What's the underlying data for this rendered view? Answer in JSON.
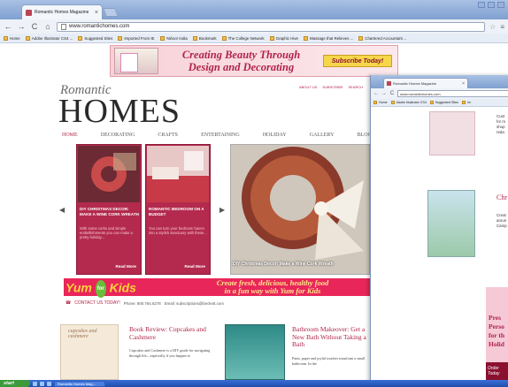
{
  "browser": {
    "tab_title": "Romantic Homes Magazine",
    "address": "www.romantichomes.com",
    "bookmarks": [
      "Home",
      "Adobe Illustrator CS4 ...",
      "Suggested Sites",
      "Imported From IE",
      "Yahoo! India",
      "Bookmark",
      "The College Network",
      "Graphic Hive",
      "Massage that Relieves ...",
      "Chartered Accountant ..."
    ]
  },
  "banner": {
    "line1": "Creating Beauty Through",
    "line2": "Design and Decorating",
    "subscribe": "Subscribe Today!"
  },
  "logo": {
    "top": "Romantic",
    "main": "HOMES"
  },
  "top_links": [
    "ABOUT US",
    "SUBSCRIBE",
    "SEARCH"
  ],
  "menu": [
    "HOME",
    "DECORATING",
    "CRAFTS",
    "ENTERTAINING",
    "HOLIDAY",
    "GALLERY",
    "BLOG"
  ],
  "cards": [
    {
      "caption": "DIY CHRISTMAS DECOR: MAKE A WINE CORK WREATH",
      "body": "With some corks and simple embellishments you can make a pretty holiday...",
      "read_more": "Read More"
    },
    {
      "caption": "ROMANTIC BEDROOM ON A BUDGET",
      "body": "You can turn your bedroom haven into a stylish sanctuary with these...",
      "read_more": "Read More"
    }
  ],
  "feature_caption": "DIY Christmas Decor: Make a Wine Cork Wreath",
  "yum": {
    "logo_yum": "Yum",
    "logo_for": "for",
    "logo_kids": "Kids",
    "tagline1": "Create fresh, delicious, healthy food",
    "tagline2": "in a fun way with Yum for Kids"
  },
  "contact": {
    "label": "CONTACT US TODAY!",
    "phone": "Phone: 800.764.6278",
    "email": "Email: subscriptions@beckett.com"
  },
  "articles": [
    {
      "img_label": "cupcakes and cashmere",
      "title": "Book Review: Cupcakes and Cashmere",
      "body": "Cupcakes and Cashmere is a DIY guide for navigating through life—especially if you happen to"
    },
    {
      "title": "Bathroom Makeover: Get a New Bath Without Taking a Bath",
      "body": "Paint, paper and joyful touches transform a small bathroom. In the"
    }
  ],
  "window2": {
    "tab_title": "Romantic Homes Magazine",
    "address": "www.romantichomes.com",
    "bookmarks": [
      "Home",
      "Adobe Illustrator CS4",
      "Suggested Sites",
      "Im"
    ],
    "text1": [
      "Cust",
      "for m",
      "shop",
      "reda"
    ],
    "title": "Chr",
    "text2": [
      "Creat",
      "aroun",
      "Camp"
    ],
    "ad_text": [
      "Pres",
      "Perso",
      "for th",
      "Holid"
    ],
    "ad_badge": "Order Today"
  },
  "taskbar": {
    "start": "start",
    "task": "Romantic Homes Mag..."
  },
  "colors": {
    "accent": "#b0244a",
    "card": "#b32a4e",
    "yum": "#e8265a"
  }
}
